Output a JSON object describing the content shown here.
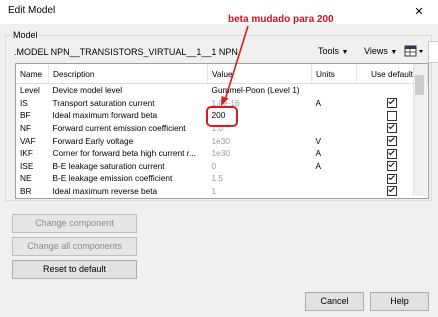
{
  "window": {
    "title": "Edit Model",
    "close_label": "✕"
  },
  "annotation": "beta mudado para 200",
  "model": {
    "group_label": "Model",
    "name": ".MODEL NPN__TRANSISTORS_VIRTUAL__1__1 NPN",
    "tools_label": "Tools",
    "views_label": "Views",
    "settings_icon": "grid-settings-icon"
  },
  "grid": {
    "headers": [
      "Name",
      "Description",
      "Value",
      "Units",
      "Use default"
    ],
    "rows": [
      {
        "name": "Level",
        "desc": "Device model level",
        "value": "Gummel-Poon (Level 1)",
        "units": "",
        "checkbox": false,
        "value_gray": false,
        "checked": false
      },
      {
        "name": "IS",
        "desc": "Transport saturation current",
        "value": "1.0e-16",
        "units": "A",
        "checkbox": true,
        "value_gray": true,
        "checked": true
      },
      {
        "name": "BF",
        "desc": "Ideal maximum forward beta",
        "value": "200",
        "units": "",
        "checkbox": true,
        "value_gray": false,
        "checked": false
      },
      {
        "name": "NF",
        "desc": "Forward current emission coefficient",
        "value": "1.0",
        "units": "",
        "checkbox": true,
        "value_gray": true,
        "checked": true
      },
      {
        "name": "VAF",
        "desc": "Forward Early voltage",
        "value": "1e30",
        "units": "V",
        "checkbox": true,
        "value_gray": true,
        "checked": true
      },
      {
        "name": "IKF",
        "desc": "Corner for forward beta high current r...",
        "value": "1e30",
        "units": "A",
        "checkbox": true,
        "value_gray": true,
        "checked": true
      },
      {
        "name": "ISE",
        "desc": "B-E leakage saturation current",
        "value": "0",
        "units": "A",
        "checkbox": true,
        "value_gray": true,
        "checked": true
      },
      {
        "name": "NE",
        "desc": "B-E leakage emission coefficient",
        "value": "1.5",
        "units": "",
        "checkbox": true,
        "value_gray": true,
        "checked": true
      },
      {
        "name": "BR",
        "desc": "Ideal maximum reverse beta",
        "value": "1",
        "units": "",
        "checkbox": true,
        "value_gray": true,
        "checked": true
      }
    ]
  },
  "buttons": {
    "change_component": "Change component",
    "change_all": "Change all components",
    "reset": "Reset to default",
    "cancel": "Cancel",
    "help": "Help"
  },
  "colors": {
    "annotation": "#c8141e",
    "highlight": "#d61e1e"
  }
}
